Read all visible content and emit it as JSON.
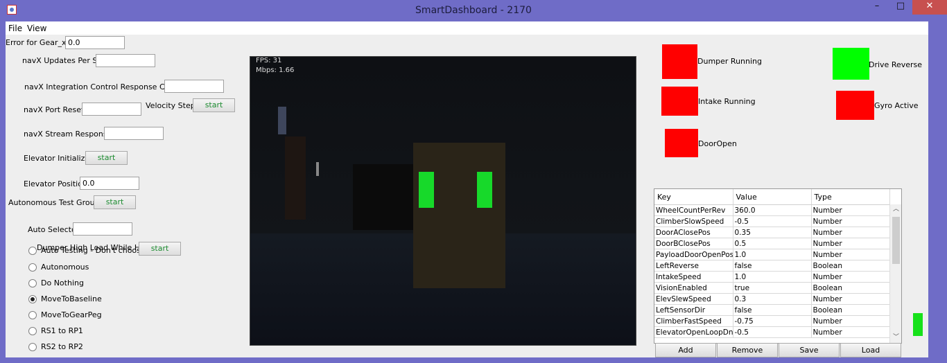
{
  "window": {
    "title": "SmartDashboard - 2170",
    "minimize": "–",
    "maximize": "□",
    "close": "✕"
  },
  "menu": {
    "file": "File",
    "view": "View"
  },
  "left": {
    "error_gear_label": "Error for Gear_x:",
    "error_gear_value": "0.0",
    "navx_updates_label": "navX Updates Per Sec",
    "navx_updates_value": "",
    "navx_integration_label": "navX Integration Control Response Count",
    "navx_integration_value": "",
    "navx_port_resets_label": "navX Port Resets",
    "navx_port_resets_value": "",
    "velocity_step_label": "Velocity Step",
    "velocity_step_button": "start",
    "navx_stream_label": "navX Stream Responses",
    "navx_stream_value": "",
    "elevator_init_label": "Elevator Initialize",
    "elevator_init_button": "start",
    "elevator_position_label": "Elevator Position",
    "elevator_position_value": "0.0",
    "auto_test_group_label": "Autonomous Test Group",
    "auto_test_group_button": "start",
    "auto_selector_label": "Auto Selector",
    "auto_selector_value": "",
    "dumper_high_label": "Dumper High Load While Held",
    "dumper_high_button": "start"
  },
  "auto_options": [
    {
      "label": "Auto Testing - Don't choose in",
      "selected": false
    },
    {
      "label": "Autonomous",
      "selected": false
    },
    {
      "label": "Do Nothing",
      "selected": false
    },
    {
      "label": "MoveToBaseline",
      "selected": true
    },
    {
      "label": "MoveToGearPeg",
      "selected": false
    },
    {
      "label": "RS1 to RP1",
      "selected": false
    },
    {
      "label": "RS2 to RP2",
      "selected": false
    }
  ],
  "camera": {
    "fps": "FPS: 31",
    "mbps": "Mbps: 1.66"
  },
  "indicators": {
    "dumper_running": {
      "label": "Dumper Running",
      "color": "#ff0000"
    },
    "drive_reverse": {
      "label": "Drive Reverse",
      "color": "#00ff00"
    },
    "intake_running": {
      "label": "Intake Running",
      "color": "#ff0000"
    },
    "gyro_active": {
      "label": "Gyro Active",
      "color": "#ff0000"
    },
    "door_open": {
      "label": "DoorOpen",
      "color": "#ff0000"
    }
  },
  "prefs": {
    "headers": [
      "Key",
      "Value",
      "Type"
    ],
    "rows": [
      [
        "WheelCountPerRev",
        "360.0",
        "Number"
      ],
      [
        "ClimberSlowSpeed",
        "-0.5",
        "Number"
      ],
      [
        "DoorAClosePos",
        "0.35",
        "Number"
      ],
      [
        "DoorBClosePos",
        "0.5",
        "Number"
      ],
      [
        "PayloadDoorOpenPos",
        "1.0",
        "Number"
      ],
      [
        "LeftReverse",
        "false",
        "Boolean"
      ],
      [
        "IntakeSpeed",
        "1.0",
        "Number"
      ],
      [
        "VisionEnabled",
        "true",
        "Boolean"
      ],
      [
        "ElevSlewSpeed",
        "0.3",
        "Number"
      ],
      [
        "LeftSensorDir",
        "false",
        "Boolean"
      ],
      [
        "ClimberFastSpeed",
        "-0.75",
        "Number"
      ],
      [
        "ElevatorOpenLoopDn",
        "-0.5",
        "Number"
      ]
    ],
    "add": "Add",
    "remove": "Remove",
    "save": "Save",
    "load": "Load"
  }
}
